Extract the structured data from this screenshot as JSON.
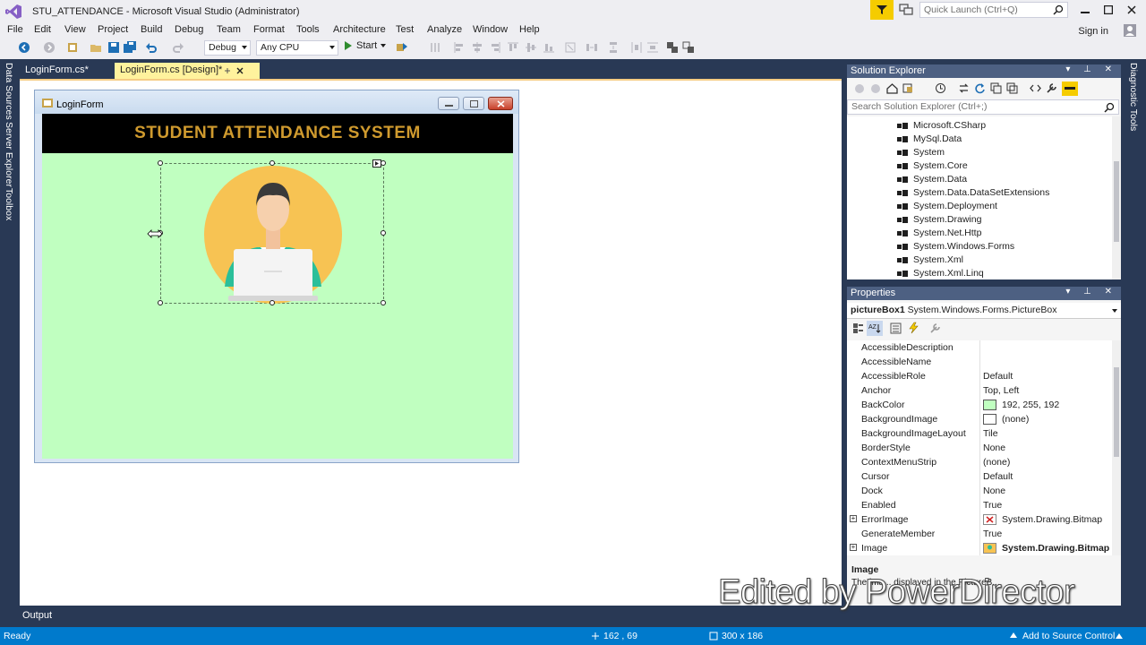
{
  "window": {
    "title": "STU_ATTENDANCE - Microsoft Visual Studio (Administrator)",
    "quick_launch_placeholder": "Quick Launch (Ctrl+Q)",
    "sign_in": "Sign in"
  },
  "menu": [
    "File",
    "Edit",
    "View",
    "Project",
    "Build",
    "Debug",
    "Team",
    "Format",
    "Tools",
    "Architecture",
    "Test",
    "Analyze",
    "Window",
    "Help"
  ],
  "toolbar": {
    "config": "Debug",
    "platform": "Any CPU",
    "start": "Start"
  },
  "side_tabs": [
    "Data Sources",
    "Server Explorer",
    "Toolbox"
  ],
  "right_tabs": [
    "Diagnostic Tools"
  ],
  "doc_tabs": [
    {
      "label": "LoginForm.cs*"
    },
    {
      "label": "LoginForm.cs [Design]*"
    }
  ],
  "form": {
    "title": "LoginForm",
    "banner": "STUDENT ATTENDANCE SYSTEM",
    "back_color": "#c0ffc0"
  },
  "solution_explorer": {
    "title": "Solution Explorer",
    "search_placeholder": "Search Solution Explorer (Ctrl+;)",
    "items": [
      "Microsoft.CSharp",
      "MySql.Data",
      "System",
      "System.Core",
      "System.Data",
      "System.Data.DataSetExtensions",
      "System.Deployment",
      "System.Drawing",
      "System.Net.Http",
      "System.Windows.Forms",
      "System.Xml",
      "System.Xml.Linq"
    ]
  },
  "properties": {
    "title": "Properties",
    "object_name": "pictureBox1",
    "object_type": "System.Windows.Forms.PictureBox",
    "rows": [
      {
        "name": "AccessibleDescription",
        "value": ""
      },
      {
        "name": "AccessibleName",
        "value": ""
      },
      {
        "name": "AccessibleRole",
        "value": "Default"
      },
      {
        "name": "Anchor",
        "value": "Top, Left"
      },
      {
        "name": "BackColor",
        "value": "192, 255, 192"
      },
      {
        "name": "BackgroundImage",
        "value": "(none)"
      },
      {
        "name": "BackgroundImageLayout",
        "value": "Tile"
      },
      {
        "name": "BorderStyle",
        "value": "None"
      },
      {
        "name": "ContextMenuStrip",
        "value": "(none)"
      },
      {
        "name": "Cursor",
        "value": "Default"
      },
      {
        "name": "Dock",
        "value": "None"
      },
      {
        "name": "Enabled",
        "value": "True"
      },
      {
        "name": "ErrorImage",
        "value": "System.Drawing.Bitmap"
      },
      {
        "name": "GenerateMember",
        "value": "True"
      },
      {
        "name": "Image",
        "value": "System.Drawing.Bitmap"
      }
    ],
    "desc_title": "Image",
    "desc_text": "The ima... displayed in the PictureB..."
  },
  "output_label": "Output",
  "watermark": "Edited by PowerDirector",
  "status": {
    "ready": "Ready",
    "position": "162 , 69",
    "size": "300 x 186",
    "source_control": "Add to Source Control"
  },
  "colors": {
    "accent": "#007acc",
    "ide_dark": "#293955",
    "banner_text": "#cf9a2e"
  }
}
